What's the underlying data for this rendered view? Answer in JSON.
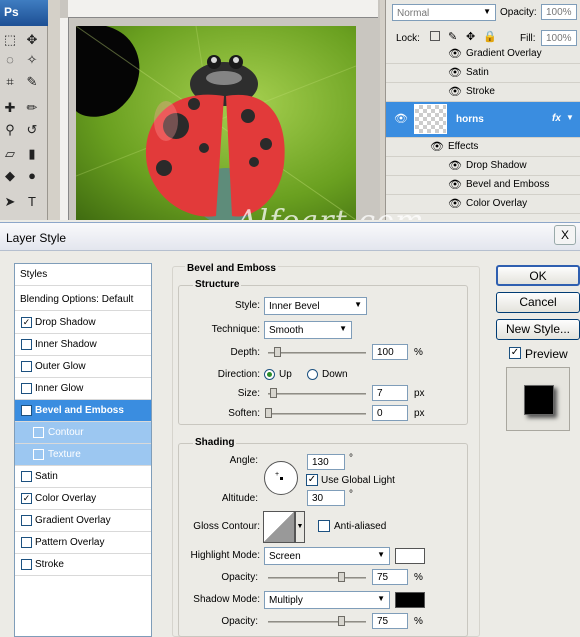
{
  "app": {
    "logo": "Ps",
    "watermark": "Alfoart.com"
  },
  "layers_panel": {
    "blend_mode": "Normal",
    "opacity_label": "Opacity:",
    "opacity_value": "100%",
    "lock_label": "Lock:",
    "fill_label": "Fill:",
    "fill_value": "100%",
    "effects_above": [
      "Gradient Overlay",
      "Satin",
      "Stroke"
    ],
    "selected_layer": "horns",
    "fx": "fx",
    "effects_header": "Effects",
    "effects_below": [
      "Drop Shadow",
      "Bevel and Emboss",
      "Color Overlay"
    ]
  },
  "dialog": {
    "title": "Layer Style",
    "close": "X",
    "styles_header": "Styles",
    "blending_options": "Blending Options: Default",
    "styles": [
      {
        "label": "Drop Shadow",
        "checked": "✓"
      },
      {
        "label": "Inner Shadow",
        "checked": ""
      },
      {
        "label": "Outer Glow",
        "checked": ""
      },
      {
        "label": "Inner Glow",
        "checked": ""
      },
      {
        "label": "Bevel and Emboss",
        "checked": "✓"
      },
      {
        "label": "Contour",
        "checked": ""
      },
      {
        "label": "Texture",
        "checked": ""
      },
      {
        "label": "Satin",
        "checked": ""
      },
      {
        "label": "Color Overlay",
        "checked": "✓"
      },
      {
        "label": "Gradient Overlay",
        "checked": ""
      },
      {
        "label": "Pattern Overlay",
        "checked": ""
      },
      {
        "label": "Stroke",
        "checked": ""
      }
    ],
    "section_title": "Bevel and Emboss",
    "structure": {
      "title": "Structure",
      "style_label": "Style:",
      "style_value": "Inner Bevel",
      "technique_label": "Technique:",
      "technique_value": "Smooth",
      "depth_label": "Depth:",
      "depth_value": "100",
      "depth_unit": "%",
      "direction_label": "Direction:",
      "direction_up": "Up",
      "direction_down": "Down",
      "size_label": "Size:",
      "size_value": "7",
      "size_unit": "px",
      "soften_label": "Soften:",
      "soften_value": "0",
      "soften_unit": "px"
    },
    "shading": {
      "title": "Shading",
      "angle_label": "Angle:",
      "angle_value": "130",
      "degree": "°",
      "use_global_light": "Use Global Light",
      "altitude_label": "Altitude:",
      "altitude_value": "30",
      "gloss_contour_label": "Gloss Contour:",
      "anti_aliased": "Anti-aliased",
      "highlight_mode_label": "Highlight Mode:",
      "highlight_mode_value": "Screen",
      "highlight_color": "#ffffff",
      "highlight_opacity_label": "Opacity:",
      "highlight_opacity_value": "75",
      "shadow_mode_label": "Shadow Mode:",
      "shadow_mode_value": "Multiply",
      "shadow_color": "#000000",
      "shadow_opacity_label": "Opacity:",
      "shadow_opacity_value": "75",
      "percent": "%"
    },
    "buttons": {
      "ok": "OK",
      "cancel": "Cancel",
      "new_style": "New Style...",
      "preview": "Preview"
    }
  }
}
